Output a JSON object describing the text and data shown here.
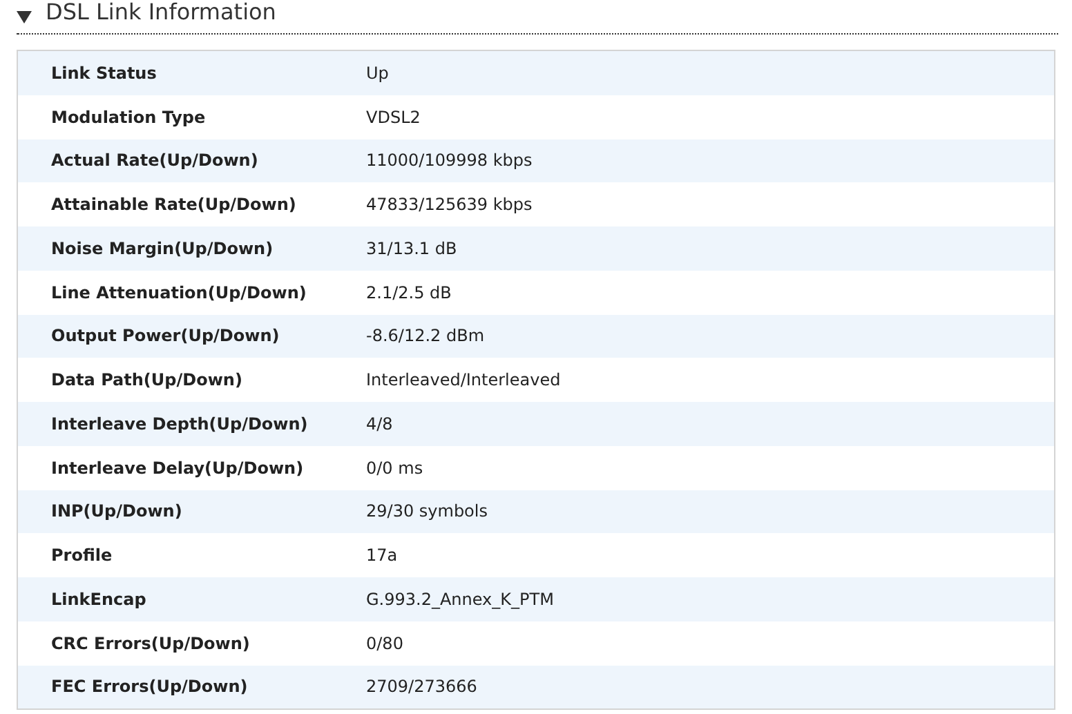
{
  "section": {
    "title": "DSL Link Information",
    "expanded": true
  },
  "rows": [
    {
      "label": "Link Status",
      "value": "Up"
    },
    {
      "label": "Modulation Type",
      "value": "VDSL2"
    },
    {
      "label": "Actual Rate(Up/Down)",
      "value": "11000/109998 kbps"
    },
    {
      "label": "Attainable Rate(Up/Down)",
      "value": "47833/125639 kbps"
    },
    {
      "label": "Noise Margin(Up/Down)",
      "value": "31/13.1 dB"
    },
    {
      "label": "Line Attenuation(Up/Down)",
      "value": "2.1/2.5 dB"
    },
    {
      "label": "Output Power(Up/Down)",
      "value": "-8.6/12.2 dBm"
    },
    {
      "label": "Data Path(Up/Down)",
      "value": "Interleaved/Interleaved"
    },
    {
      "label": "Interleave Depth(Up/Down)",
      "value": "4/8"
    },
    {
      "label": "Interleave Delay(Up/Down)",
      "value": "0/0 ms"
    },
    {
      "label": "INP(Up/Down)",
      "value": "29/30 symbols"
    },
    {
      "label": "Profile",
      "value": "17a"
    },
    {
      "label": "LinkEncap",
      "value": "G.993.2_Annex_K_PTM"
    },
    {
      "label": "CRC Errors(Up/Down)",
      "value": "0/80"
    },
    {
      "label": "FEC Errors(Up/Down)",
      "value": "2709/273666"
    }
  ]
}
